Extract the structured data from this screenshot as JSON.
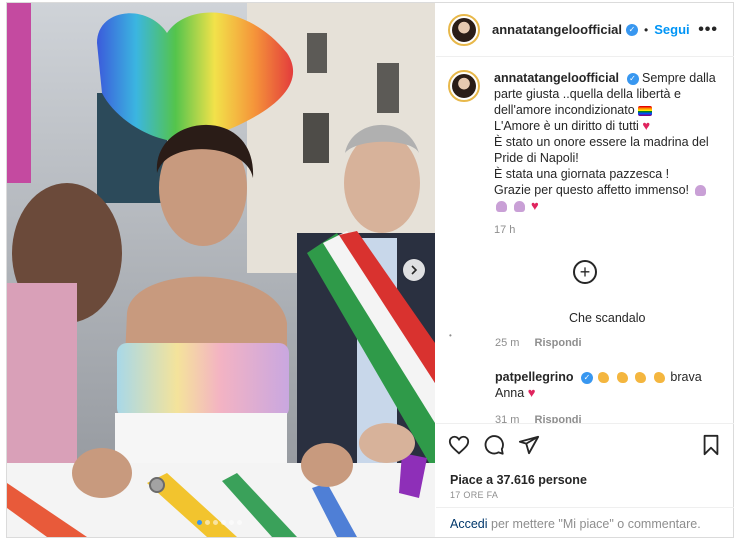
{
  "post": {
    "username": "annatatangeloofficial",
    "follow_label": "Segui",
    "more_label": "•••",
    "caption_lines": [
      "Sempre dalla parte giusta ..quella della libertà e dell'amore incondizionato",
      "L'Amore è un diritto di tutti",
      "È stato un onore essere la madrina del Pride di Napoli!",
      "È stata una giornata pazzesca !",
      "Grazie per questo affetto immenso!"
    ],
    "caption_time": "17 h",
    "comments": [
      {
        "username": "",
        "text": "Che scandalo",
        "time": "25 m",
        "reply_label": "Rispondi"
      },
      {
        "username": "patpellegrino",
        "text": "brava Anna",
        "time": "31 m",
        "reply_label": "Rispondi"
      }
    ],
    "likes_text": "Piace a 37.616 persone",
    "posted_ago": "17 ORE FA",
    "login_label": "Accedi",
    "add_comment_text": "per mettere \"Mi piace\" o commentare."
  },
  "carousel": {
    "slides": 6,
    "active_index": 0
  },
  "icons": {
    "heart": "heart-icon",
    "comment": "comment-icon",
    "share": "share-icon",
    "save": "bookmark-icon",
    "verified": "verified-badge-icon",
    "add": "plus-circle-icon",
    "next": "chevron-right-icon"
  },
  "colors": {
    "accent": "#0095f6",
    "verified": "#3897f0",
    "muted": "#8e8e8e",
    "text": "#262626"
  }
}
